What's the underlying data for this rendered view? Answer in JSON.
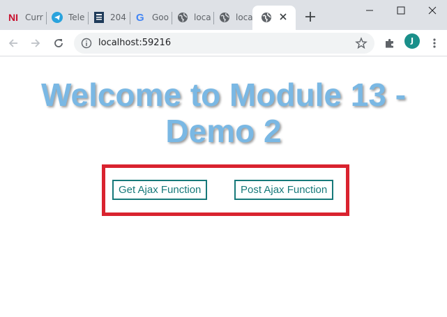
{
  "browser": {
    "tabs": [
      {
        "title": "Curr",
        "icon": "n-logo-icon"
      },
      {
        "title": "Tele",
        "icon": "telegram-icon"
      },
      {
        "title": "204",
        "icon": "document-icon"
      },
      {
        "title": "Goo",
        "icon": "google-icon"
      },
      {
        "title": "loca",
        "icon": "globe-icon"
      },
      {
        "title": "loca",
        "icon": "globe-icon"
      },
      {
        "title": "",
        "icon": "globe-icon",
        "active": true
      }
    ],
    "address": "localhost:59216",
    "profile_initial": "J",
    "accent_color": "#1a8f8a"
  },
  "page": {
    "heading": "Welcome to Module 13 - Demo 2",
    "heading_color": "#7ab8e4",
    "highlight_color": "#d9232f",
    "buttons": {
      "get_label": "Get Ajax Function",
      "post_label": "Post Ajax Function"
    },
    "button_color": "#17797a"
  }
}
